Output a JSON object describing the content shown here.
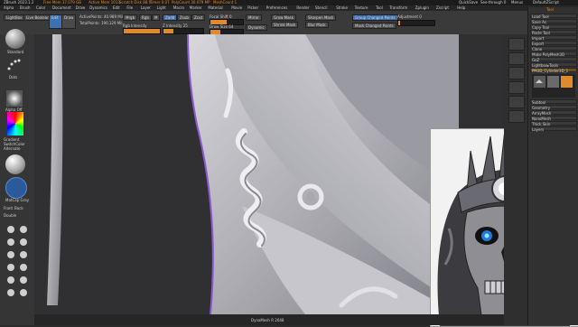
{
  "titlebar": {
    "title": "ZBrush 2023.1.2",
    "segments": [
      "Free Mem 37.079 GB",
      "Active Mem 1013",
      "Scratch Disk 88 0",
      "Timer 0.07",
      "PolyCount 30.079 MP",
      "MeshCount 1"
    ],
    "window_title": "QuickSave",
    "menu_right": [
      "See-through 0",
      "Menus",
      "DefaultZScript"
    ]
  },
  "menubar": {
    "items": [
      "Alpha",
      "Brush",
      "Color",
      "Document",
      "Draw",
      "Dynamics",
      "Edit",
      "File",
      "Layer",
      "Light",
      "Macro",
      "Marker",
      "Material",
      "Movie",
      "Picker",
      "Preferences",
      "Render",
      "Stencil",
      "Stroke",
      "Texture",
      "Tool",
      "Transform",
      "Zplugin",
      "Zscript",
      "Help"
    ]
  },
  "toolbar": {
    "lightbox": "LightBox",
    "live_boolean": "Live Boolean",
    "edit": "Edit",
    "draw": "Draw",
    "move": "Move",
    "scale": "Scale",
    "rotate": "Rotate",
    "active_points": "ActivePoints: 40.989 Mil",
    "total_points": "TotalPoints: 190.129 Mil",
    "mrgb": "Mrgb",
    "rgb": "Rgb",
    "m": "M",
    "zadd": "Zadd",
    "zsub": "Zsub",
    "zcut": "Zcut",
    "rgb_intensity": "Rgb Intensity",
    "z_intensity": "Z Intensity 25",
    "focal_shift": "Focal Shift 0",
    "draw_size": "Draw Size 64",
    "dynamic": "Dynamic",
    "z_intensity_value": 0.25,
    "draw_size_value": 0.3,
    "focal_value": 0.5,
    "mirror": "Mirror",
    "grow_mask": "Grow Mask",
    "shrink_mask": "Shrink Mask",
    "sharpen_mask": "Sharpen Mask",
    "blur_mask": "Blur Mask",
    "group_changed_points": "Group Changed Points",
    "adjustment": "Adjustment 0",
    "mask_changed_points": "Mask Changed Points"
  },
  "left_shelf": {
    "brush_name": "Standard",
    "stroke_name": "Dots",
    "alpha_name": "Alpha Off",
    "texture_name": "Texture Off",
    "material_name": "MatCap Gray",
    "gradient": "Gradient",
    "switch_color": "SwitchColor",
    "alternate": "Alternate",
    "sub_labels": [
      "Front",
      "Back",
      "Double"
    ]
  },
  "tool_panel": {
    "header": "Tool",
    "buttons": [
      "Load Tool",
      "Save As",
      "Copy Tool",
      "Paste Tool",
      "Import",
      "Export",
      "Clone",
      "Make PolyMesh3D",
      "GoZ",
      "All",
      "Visible",
      "R"
    ],
    "lightbox_tools": "Lightbox▸Tools",
    "tool_name": "PM3D_Cylinder3D_1",
    "items": [
      "Subtool",
      "Geometry",
      "ArrayMesh",
      "NanoMesh",
      "Thick Skin",
      "Layers",
      "Fiber Mesh",
      "Geometry HD",
      "Preview",
      "Surface",
      "Deformation",
      "Masking",
      "Visibility",
      "Polygroups",
      "Contact",
      "Morph Target",
      "Polypaint",
      "UV Map",
      "Texture Map",
      "Displacement Map",
      "Normal Map",
      "Vector Displacement Map",
      "Display Properties",
      "Unified Skin",
      "Initialize",
      "Import",
      "Export"
    ]
  },
  "status": {
    "text": "DynaMesh R 2048"
  },
  "colors": {
    "accent_orange": "#e08a2c",
    "accent_blue": "#3d6fb3",
    "ui_dark": "#2b2b2b",
    "clay": "#b9b9bf"
  },
  "icons": [
    "brush-standard-icon",
    "stroke-dots-icon",
    "alpha-icon",
    "texture-icon",
    "material-matcap-icon",
    "color-picker-icon",
    "bpr-icon",
    "scroll-icon",
    "zoom-icon",
    "actual-icon",
    "aahalf-icon",
    "persp-icon",
    "floor-icon",
    "local-icon",
    "frame-icon",
    "move-icon",
    "zoom3d-icon",
    "rotate-icon",
    "transp-icon",
    "ghost-icon",
    "solo-icon",
    "xpose-icon"
  ]
}
